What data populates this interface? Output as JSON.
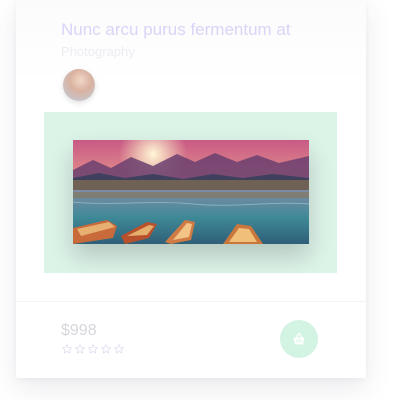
{
  "card": {
    "title": "Nunc arcu purus fermentum at",
    "category": "Photography",
    "image_alt": "Mountain lake with boats at sunset",
    "price": "$998",
    "rating": {
      "value": 0,
      "max": 5
    }
  },
  "icons": {
    "cart": "shopping-basket-icon",
    "star": "star-outline-icon",
    "avatar": "author-avatar"
  },
  "colors": {
    "title": "#d8d5f7",
    "category": "#ecedf2",
    "panel": "#dcf3e8",
    "cart_button": "#d3f3e3",
    "price": "#d6d6dd",
    "star": "#dedff0"
  }
}
